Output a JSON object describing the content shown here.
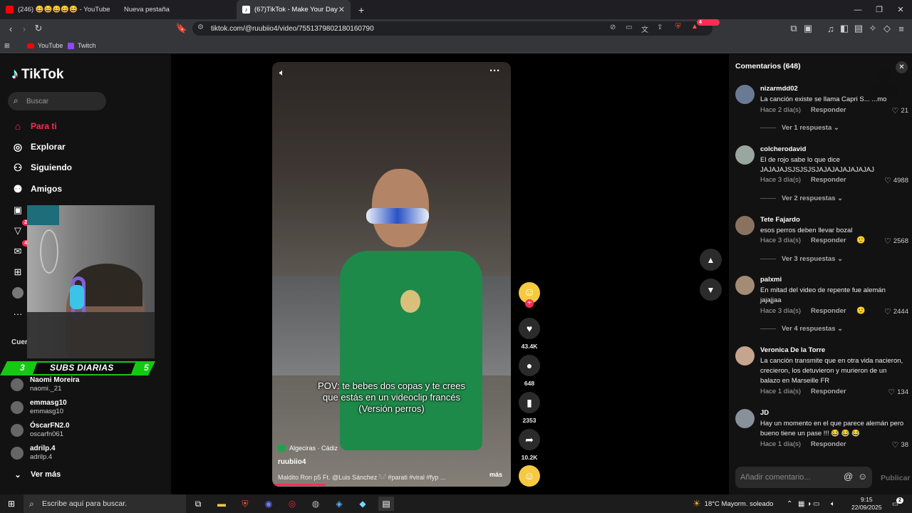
{
  "browser": {
    "tabs": [
      {
        "label": "(246) 😄😄😄😄😄 - YouTube",
        "icon": "youtube-icon"
      },
      {
        "label": "Nueva pestaña",
        "icon": "blank-tab-icon"
      },
      {
        "label": "(67)TikTok - Make Your Day",
        "icon": "tiktok-icon",
        "active": true
      }
    ],
    "new_tab": "+",
    "url": "tiktok.com/@ruubiio4/video/7551379802180160790",
    "bookmarks": [
      "YouTube",
      "Twitch"
    ],
    "notification_badge": "4"
  },
  "tiktok": {
    "logo_text": "TikTok",
    "search_placeholder": "Buscar",
    "nav": [
      {
        "label": "Para ti",
        "icon": "home-icon",
        "active": true
      },
      {
        "label": "Explorar",
        "icon": "compass-icon"
      },
      {
        "label": "Siguiendo",
        "icon": "following-icon"
      },
      {
        "label": "Amigos",
        "icon": "friends-icon"
      }
    ],
    "mini_badges": {
      "activity": "21",
      "messages": "46"
    },
    "following_heading": "Cuen",
    "subs_overlay": {
      "left": "3",
      "text": "SUBS DIARIAS",
      "right": "5"
    },
    "following": [
      {
        "name": "Naomi Moreira",
        "handle": "naomi._21"
      },
      {
        "name": "emmasg10",
        "handle": "emmasg10"
      },
      {
        "name": "ÓscarFN2.0",
        "handle": "oscarfn061"
      },
      {
        "name": "adrilp.4",
        "handle": "adrilp.4"
      }
    ],
    "see_more": "Ver más"
  },
  "video": {
    "caption_lines": [
      "POV: te bebes dos copas y te crees",
      "que estás en un videoclip francés",
      "(Versión perros)"
    ],
    "location": "Algeciras · Cádiz",
    "author": "ruubiio4",
    "music": "Maldito Ron p5 Ft. @Luis Sánchez 𓆩𓆪  #parati  #viral  #fyp  ...",
    "more": "más",
    "likes": "43.4K",
    "comments": "648",
    "saves": "2353",
    "shares": "10.2K"
  },
  "comments_panel": {
    "title": "Comentarios (648)",
    "reply_label": "Responder",
    "add_placeholder": "Añadir comentario...",
    "publish": "Publicar",
    "comments": [
      {
        "user": "nizarmdd02",
        "text": "La canción existe se llama Capri S... ...mo",
        "time": "Hace 2 día(s)",
        "likes": "21",
        "replies": "Ver 1 respuesta"
      },
      {
        "user": "colcherodavid",
        "text": "El de rojo sabe lo que dice JAJAJAJSJSJSJSJAJAJAJAJAJAJAJ",
        "time": "Hace 3 día(s)",
        "likes": "4988",
        "replies": "Ver 2 respuestas"
      },
      {
        "user": "Tete Fajardo",
        "text": "esos perros deben llevar bozal",
        "time": "Hace 3 día(s)",
        "likes": "2568",
        "replies": "Ver 3 respuestas"
      },
      {
        "user": "palxmi",
        "text": "En mitad del video de repente fue alemán jajajjaa",
        "time": "Hace 3 día(s)",
        "likes": "2444",
        "replies": "Ver 4 respuestas"
      },
      {
        "user": "Veronica De la Torre",
        "text": "La canción transmite que en otra vida nacieron, crecieron, los detuvieron y murieron de un balazo en Marseille FR",
        "time": "Hace 1 día(s)",
        "likes": "134"
      },
      {
        "user": "JD",
        "text": "Hay un momento en el que parece alemán pero bueno tiene un pase !!! 😂 😂 😂",
        "time": "Hace 1 día(s)",
        "likes": "38"
      }
    ]
  },
  "taskbar": {
    "search_placeholder": "Escribe aquí para buscar.",
    "weather_temp": "18°C",
    "weather_text": "Mayorm. soleado",
    "time": "9:15",
    "date": "22/09/2025",
    "notif_count": "2"
  },
  "colors": {
    "tiktok_red": "#fe2c55",
    "subs_green": "#14c814"
  }
}
